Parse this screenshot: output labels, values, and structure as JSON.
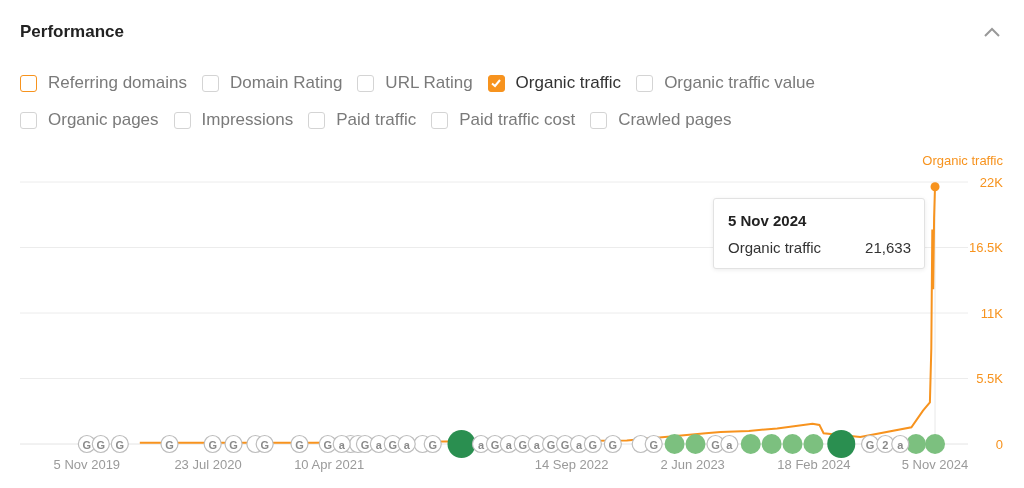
{
  "panel": {
    "title": "Performance",
    "expanded": true
  },
  "metrics": [
    {
      "label": "Referring domains",
      "checked": false,
      "color": "#f7931e"
    },
    {
      "label": "Domain Rating",
      "checked": false,
      "color": "#d4d4d4"
    },
    {
      "label": "URL Rating",
      "checked": false,
      "color": "#d4d4d4"
    },
    {
      "label": "Organic traffic",
      "checked": true,
      "color": "#f7931e"
    },
    {
      "label": "Organic traffic value",
      "checked": false,
      "color": "#d4d4d4"
    },
    {
      "label": "Organic pages",
      "checked": false,
      "color": "#d4d4d4"
    },
    {
      "label": "Impressions",
      "checked": false,
      "color": "#d4d4d4"
    },
    {
      "label": "Paid traffic",
      "checked": false,
      "color": "#d4d4d4"
    },
    {
      "label": "Paid traffic cost",
      "checked": false,
      "color": "#d4d4d4"
    },
    {
      "label": "Crawled pages",
      "checked": false,
      "color": "#d4d4d4"
    }
  ],
  "chart_data": {
    "type": "line",
    "grid": true,
    "x": [
      "2020-02-27",
      "2020-06-13",
      "2020-12-30",
      "2021-03-08",
      "2021-12-14",
      "2023-01-11",
      "2023-06-30",
      "2023-08-01",
      "2023-10-01",
      "2023-12-01",
      "2024-02-15",
      "2024-03-01",
      "2024-03-10",
      "2024-05-28",
      "2024-09-15",
      "2024-10-10",
      "2024-10-25",
      "2024-10-28",
      "2024-10-30",
      "2024-11-01",
      "2024-11-03",
      "2024-11-05"
    ],
    "series": [
      {
        "name": "Organic traffic",
        "color": "#f7931e",
        "values": [
          100,
          100,
          100,
          100,
          200,
          300,
          900,
          1000,
          1100,
          1300,
          1700,
          1600,
          900,
          600,
          1400,
          2800,
          3500,
          8000,
          18000,
          13000,
          19000,
          21600
        ]
      }
    ],
    "xlim": [
      "2019-06-14",
      "2025-01-15"
    ],
    "ylim": [
      0,
      22000
    ],
    "xticks": [
      {
        "value": "2019-11-05",
        "label": "5 Nov 2019"
      },
      {
        "value": "2020-07-23",
        "label": "23 Jul 2020"
      },
      {
        "value": "2021-04-10",
        "label": "10 Apr 2021"
      },
      {
        "value": "2022-09-14",
        "label": "14 Sep 2022"
      },
      {
        "value": "2023-06-02",
        "label": "2 Jun 2023"
      },
      {
        "value": "2024-02-18",
        "label": "18 Feb 2024"
      },
      {
        "value": "2024-11-05",
        "label": "5 Nov 2024"
      }
    ],
    "yticks": [
      {
        "value": 0,
        "label": "0"
      },
      {
        "value": 5500,
        "label": "5.5K"
      },
      {
        "value": 11000,
        "label": "11K"
      },
      {
        "value": 16500,
        "label": "16.5K"
      },
      {
        "value": 22000,
        "label": "22K"
      }
    ],
    "annotations": [
      {
        "x": "2019-11-05",
        "y": 0,
        "text": "G"
      },
      {
        "x": "2019-12-05",
        "y": 0,
        "text": "G"
      },
      {
        "x": "2020-01-15",
        "y": 0,
        "text": "G"
      },
      {
        "x": "2020-05-01",
        "y": 0,
        "text": "G"
      },
      {
        "x": "2020-08-02",
        "y": 0,
        "text": "G"
      },
      {
        "x": "2020-09-16",
        "y": 0,
        "text": "G"
      },
      {
        "x": "2020-11-22",
        "y": 0,
        "text": "G"
      },
      {
        "x": "2021-02-05",
        "y": 0,
        "text": "G"
      },
      {
        "x": "2021-04-07",
        "y": 0,
        "text": "G"
      },
      {
        "x": "2021-05-07",
        "y": 0,
        "text": "a"
      },
      {
        "x": "2021-06-26",
        "y": 0,
        "text": "G"
      },
      {
        "x": "2021-07-26",
        "y": 0,
        "text": "a"
      },
      {
        "x": "2021-08-25",
        "y": 0,
        "text": "G"
      },
      {
        "x": "2021-09-24",
        "y": 0,
        "text": "a"
      },
      {
        "x": "2021-11-19",
        "y": 0,
        "text": "G"
      },
      {
        "x": "2022-03-03",
        "y": 0,
        "text": "a"
      },
      {
        "x": "2022-04-02",
        "y": 0,
        "text": "G"
      },
      {
        "x": "2022-05-02",
        "y": 0,
        "text": "a"
      },
      {
        "x": "2022-06-01",
        "y": 0,
        "text": "G"
      },
      {
        "x": "2022-07-01",
        "y": 0,
        "text": "a"
      },
      {
        "x": "2022-08-01",
        "y": 0,
        "text": "G"
      },
      {
        "x": "2022-08-31",
        "y": 0,
        "text": "G"
      },
      {
        "x": "2022-09-30",
        "y": 0,
        "text": "a"
      },
      {
        "x": "2022-10-30",
        "y": 0,
        "text": "G"
      },
      {
        "x": "2022-12-12",
        "y": 0,
        "text": "G"
      },
      {
        "x": "2023-03-10",
        "y": 0,
        "text": "G"
      },
      {
        "x": "2023-07-21",
        "y": 0,
        "text": "G"
      },
      {
        "x": "2023-08-20",
        "y": 0,
        "text": "a"
      },
      {
        "x": "2024-06-18",
        "y": 0,
        "text": "G"
      },
      {
        "x": "2024-07-21",
        "y": 0,
        "text": "2"
      },
      {
        "x": "2024-08-22",
        "y": 0,
        "text": "a"
      }
    ]
  },
  "tooltip": {
    "date": "5 Nov 2024",
    "rows": [
      {
        "label": "Organic traffic",
        "value": "21,633"
      }
    ]
  }
}
